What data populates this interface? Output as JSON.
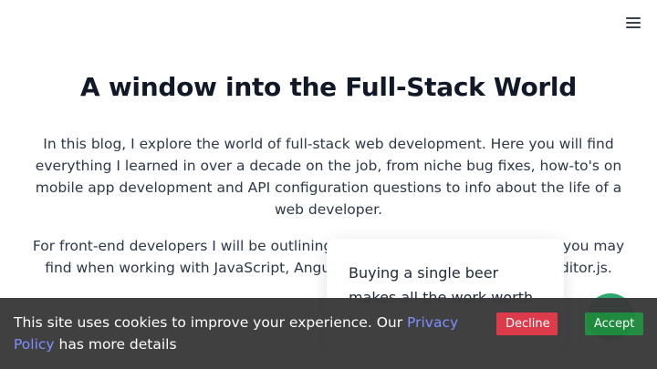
{
  "header": {
    "menu_icon": "hamburger-menu-icon"
  },
  "main": {
    "title": "A window into the Full-Stack World",
    "paragraph1": "In this blog, I explore the world of full-stack web development. Here you will find everything I learned in over a decade on the job, from niche bug fixes, how-to's on mobile app development and API configuration questions to info about the life of a web developer.",
    "paragraph2": "For front-end developers I will be outlining tips and tricks, along with bugs you may find when working with JavaScript, Angular, React, TypeScript, Vue and Editor.js."
  },
  "popup": {
    "text": "Buying a single beer makes all the work worth it"
  },
  "cookie_banner": {
    "text_before": "This site uses cookies to improve your experience. Our ",
    "link_label": "Privacy Policy",
    "text_after": " has more details",
    "decline_label": "Decline",
    "accept_label": "Accept"
  },
  "colors": {
    "banner_bg": "#3a3a3a",
    "link": "#7b8cff",
    "decline": "#dc3545",
    "accept": "#1e8a3c",
    "fab": "#2fa870"
  }
}
